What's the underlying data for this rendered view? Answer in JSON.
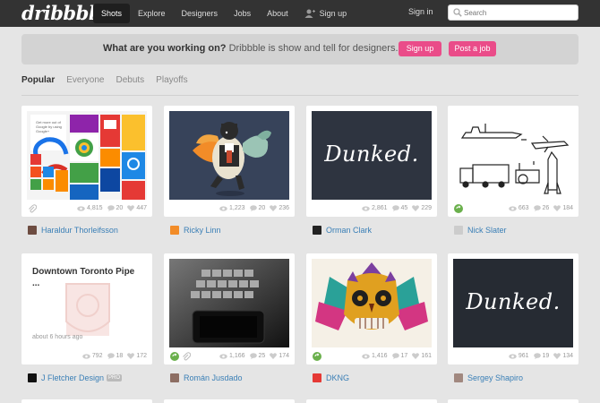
{
  "header": {
    "logo": "dribbble",
    "nav": [
      "Shots",
      "Explore",
      "Designers",
      "Jobs",
      "About",
      "Sign up"
    ],
    "signin": "Sign in",
    "search_placeholder": "Search"
  },
  "banner": {
    "question": "What are you working on?",
    "tagline": " Dribbble is show and tell for designers.",
    "signup": "Sign up",
    "post_job": "Post a job"
  },
  "tabs": [
    "Popular",
    "Everyone",
    "Debuts",
    "Playoffs"
  ],
  "colors": {
    "accent": "#ea4c89",
    "link": "#3a7fb6",
    "nav_bg": "#333333"
  },
  "shots": [
    {
      "views": "4,815",
      "comments": "20",
      "likes": "447",
      "author": "Haraldur Thorleifsson"
    },
    {
      "views": "1,223",
      "comments": "20",
      "likes": "236",
      "author": "Ricky Linn"
    },
    {
      "views": "2,861",
      "comments": "45",
      "likes": "229",
      "author": "Orman Clark",
      "title": "Dunked."
    },
    {
      "views": "663",
      "comments": "26",
      "likes": "184",
      "author": "Nick Slater"
    },
    {
      "views": "792",
      "comments": "18",
      "likes": "172",
      "author": "J Fletcher Design",
      "badge": "PRO",
      "title": "Downtown Toronto Pipe ...",
      "meta": "about 6 hours ago"
    },
    {
      "views": "1,166",
      "comments": "25",
      "likes": "174",
      "author": "Román Jusdado"
    },
    {
      "views": "1,416",
      "comments": "17",
      "likes": "161",
      "author": "DKNG"
    },
    {
      "views": "961",
      "comments": "19",
      "likes": "134",
      "author": "Sergey Shapiro",
      "title": "Dunked."
    }
  ]
}
